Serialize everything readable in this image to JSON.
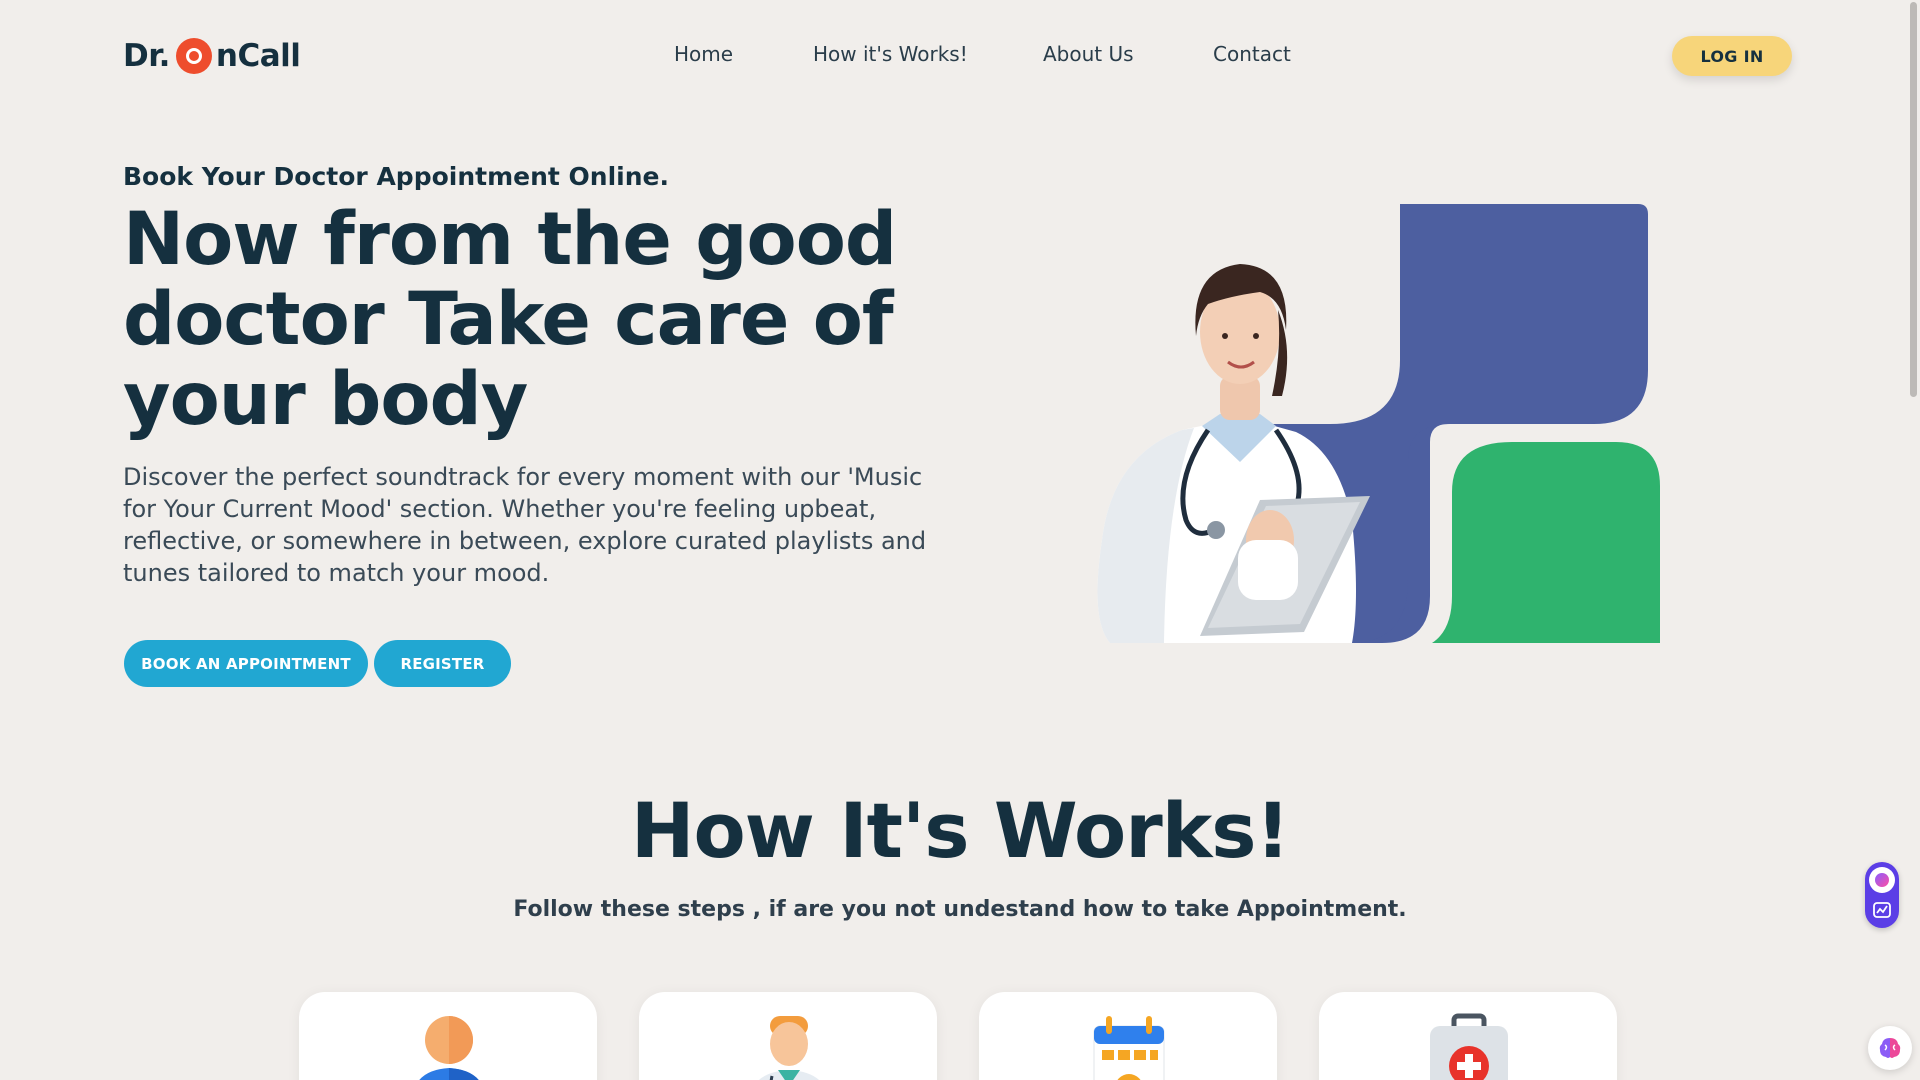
{
  "header": {
    "logo_prefix": "Dr.",
    "logo_suffix": "nCall",
    "nav": [
      "Home",
      "How it's Works!",
      "About Us",
      "Contact"
    ],
    "login_label": "LOG IN"
  },
  "hero": {
    "kicker": "Book Your Doctor Appointment Online.",
    "title": "Now from the good doctor Take care of your body",
    "description": "Discover the perfect soundtrack for every moment with our 'Music for Your Current Mood' section. Whether you're feeling upbeat, reflective, or somewhere in between, explore curated playlists and tunes tailored to match your mood.",
    "book_label": "BOOK AN APPOINTMENT",
    "register_label": "REGISTER"
  },
  "how": {
    "title": "How It's Works!",
    "subtitle": "Follow these steps , if are you not undestand how to take Appointment.",
    "cards": [
      {
        "icon": "user-icon"
      },
      {
        "icon": "doctor-icon"
      },
      {
        "icon": "calendar-icon"
      },
      {
        "icon": "medical-kit-icon"
      }
    ]
  },
  "colors": {
    "background": "#f1eeeb",
    "heading": "#15303f",
    "primary_button": "#21a7d2",
    "login_button": "#f7d57a",
    "logo_accent": "#ee4d2d",
    "shape_blue": "#4d5fa0",
    "shape_green": "#2fb36e"
  }
}
